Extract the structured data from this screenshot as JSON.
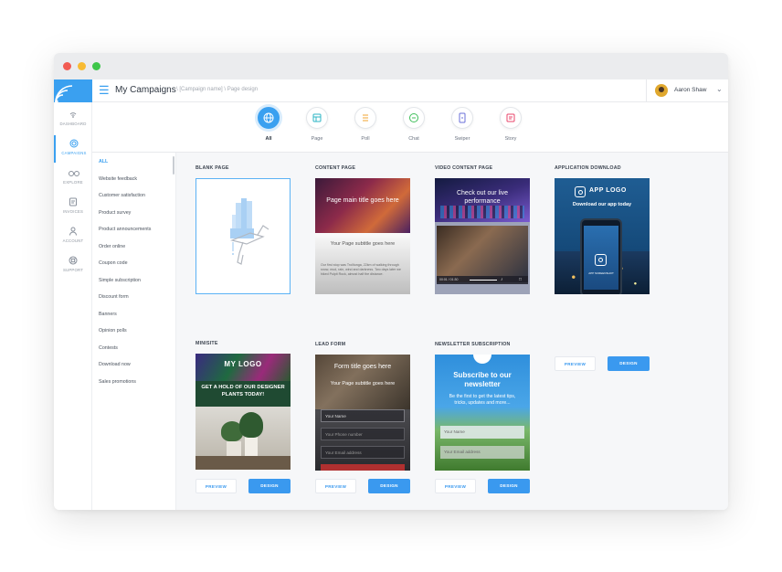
{
  "header": {
    "title": "My Campaigns",
    "breadcrumb": "\\ [Campaign name] \\ Page design",
    "user_name": "Aaron Shaw"
  },
  "sidebar": {
    "items": [
      {
        "label": "DASHBOARD",
        "icon": "signal-icon"
      },
      {
        "label": "CAMPAIGNS",
        "icon": "target-icon",
        "active": true
      },
      {
        "label": "EXPLORE",
        "icon": "binoculars-icon"
      },
      {
        "label": "INVOICES",
        "icon": "invoice-icon"
      },
      {
        "label": "ACCOUNT",
        "icon": "user-icon"
      },
      {
        "label": "SUPPORT",
        "icon": "lifebuoy-icon"
      }
    ]
  },
  "tabs": [
    {
      "label": "All",
      "icon": "globe-icon",
      "active": true
    },
    {
      "label": "Page",
      "icon": "page-icon",
      "color": "#2cb5c5"
    },
    {
      "label": "Poll",
      "icon": "list-icon",
      "color": "#f0a631"
    },
    {
      "label": "Chat",
      "icon": "chat-icon",
      "color": "#3fbf5a"
    },
    {
      "label": "Swiper",
      "icon": "swiper-icon",
      "color": "#6a6fd8"
    },
    {
      "label": "Story",
      "icon": "story-icon",
      "color": "#e8446b"
    }
  ],
  "categories": [
    "ALL",
    "Website feedback",
    "Customer satisfaction",
    "Product survey",
    "Product announcements",
    "Order online",
    "Coupon code",
    "Simple subscription",
    "Discount form",
    "Banners",
    "Opinion polls",
    "Contests",
    "Download now",
    "Sales promotions"
  ],
  "buttons": {
    "design": "DESIGN",
    "preview": "PREVIEW"
  },
  "cards": [
    {
      "title": "BLANK PAGE"
    },
    {
      "title": "CONTENT PAGE",
      "thumb_title": "Page main title goes here",
      "thumb_subtitle": "Your Page subtitle goes here",
      "thumb_body": "Our first stop was Trolltunga, 22km of walking through snow, mud, rain, wind and darkness. Two days later we hiked Pulpit Rock, almost half the distance."
    },
    {
      "title": "VIDEO CONTENT PAGE",
      "thumb_title": "Check out our live performance",
      "video_time": "00:01 / 01:30"
    },
    {
      "title": "APPLICATION DOWNLOAD",
      "app_logo": "APP LOGO",
      "thumb_title": "Download our app today",
      "phone_caption": "APP SCREENSHOT"
    },
    {
      "title": "MINISITE",
      "logo": "MY LOGO",
      "thumb_title": "GET A HOLD OF OUR DESIGNER PLANTS TODAY!"
    },
    {
      "title": "LEAD FORM",
      "thumb_title": "Form title goes here",
      "thumb_subtitle": "Your Page subtitle goes here",
      "fields": [
        "Your Name",
        "Your Phone number",
        "Your Email address"
      ]
    },
    {
      "title": "NEWSLETTER SUBSCRIPTION",
      "thumb_title": "Subscribe to our newsletter",
      "thumb_subtitle": "Be the first to get the latest tips, tricks, updates and more...",
      "fields": [
        "Your Name",
        "Your Email address"
      ]
    }
  ],
  "colors": {
    "accent": "#3a99ef",
    "sidebar_logo": "#3aa0f0"
  }
}
